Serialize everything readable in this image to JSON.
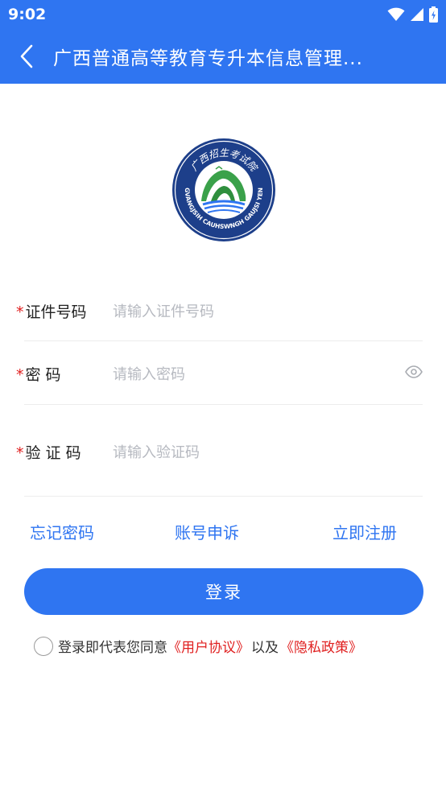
{
  "status_bar": {
    "time": "9:02"
  },
  "app_bar": {
    "title": "广西普通高等教育专升本信息管理..."
  },
  "logo": {
    "top_text": "广西招生考试院",
    "bottom_text": "GVANGJSIH CAUHSWNGH GAUJSI YEN"
  },
  "form": {
    "id_number": {
      "required_mark": "*",
      "label": "证件号码",
      "placeholder": "请输入证件号码",
      "value": ""
    },
    "password": {
      "required_mark": "*",
      "label": "密 码",
      "placeholder": "请输入密码",
      "value": ""
    },
    "captcha": {
      "required_mark": "*",
      "label": "验 证 码",
      "placeholder": "请输入验证码",
      "value": ""
    }
  },
  "links": {
    "forgot_password": "忘记密码",
    "account_appeal": "账号申诉",
    "register": "立即注册"
  },
  "login_button": {
    "label": "登录"
  },
  "agreement": {
    "prefix": "登录即代表您同意",
    "user_agreement": "《用户协议》",
    "conjunction": "以及",
    "privacy_policy": "《隐私政策》"
  },
  "colors": {
    "primary": "#2f75f1",
    "required": "#e02020",
    "placeholder": "#b6b9c0"
  }
}
